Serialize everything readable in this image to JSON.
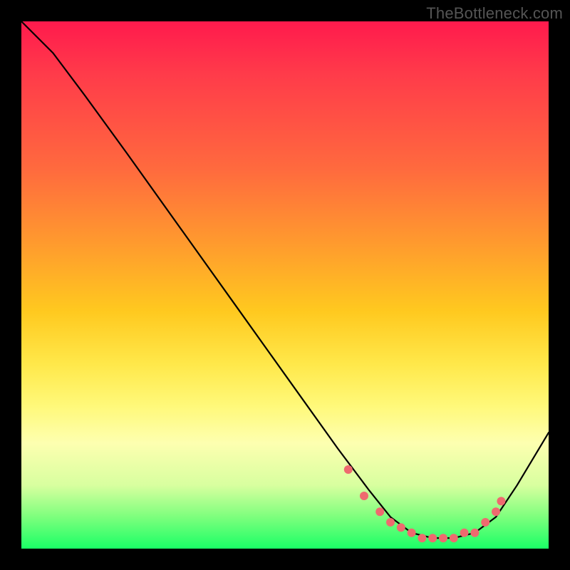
{
  "watermark": "TheBottleneck.com",
  "colors": {
    "dot": "#ee6a6f",
    "curve": "#000000"
  },
  "chart_data": {
    "type": "line",
    "title": "",
    "xlabel": "",
    "ylabel": "",
    "xlim": [
      0,
      100
    ],
    "ylim": [
      0,
      100
    ],
    "grid": false,
    "legend": null,
    "series": [
      {
        "name": "curve",
        "x": [
          0,
          6,
          12,
          20,
          30,
          40,
          50,
          60,
          66,
          70,
          74,
          78,
          82,
          86,
          90,
          94,
          100
        ],
        "y": [
          100,
          94,
          86,
          75,
          61,
          47,
          33,
          19,
          11,
          6,
          3,
          2,
          2,
          3,
          6,
          12,
          22
        ]
      }
    ],
    "markers": {
      "name": "highlight-dots",
      "x": [
        62,
        65,
        68,
        70,
        72,
        74,
        76,
        78,
        80,
        82,
        84,
        86,
        88,
        90,
        91
      ],
      "y": [
        15,
        10,
        7,
        5,
        4,
        3,
        2,
        2,
        2,
        2,
        3,
        3,
        5,
        7,
        9
      ]
    }
  }
}
